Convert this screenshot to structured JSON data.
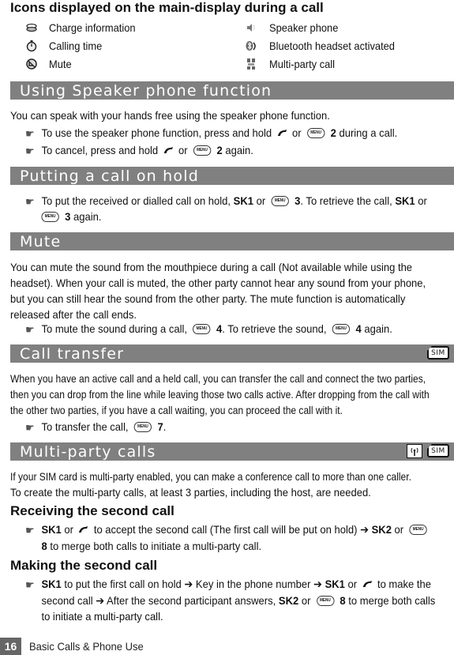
{
  "title": "Icons displayed on the main-display during a call",
  "icons": {
    "left": [
      {
        "icon": "charge-info-icon",
        "label": "Charge information"
      },
      {
        "icon": "stopwatch-icon",
        "label": "Calling time"
      },
      {
        "icon": "mute-icon",
        "label": "Mute"
      }
    ],
    "right": [
      {
        "icon": "speaker-icon",
        "label": "Speaker phone"
      },
      {
        "icon": "bluetooth-headset-icon",
        "label": "Bluetooth headset activated"
      },
      {
        "icon": "multi-party-icon",
        "label": "Multi-party call"
      }
    ]
  },
  "keys": {
    "menu": "MENU",
    "sim": "SIM",
    "hand": "☛",
    "arrow": "➔"
  },
  "speaker": {
    "heading": "Using Speaker phone function",
    "intro": "You can speak with your hands free using the speaker phone function.",
    "b1": {
      "t1": "To use the speaker phone function, press and hold",
      "t2": "or",
      "t3": "2",
      "t4": "during a call."
    },
    "b2": {
      "t1": "To cancel, press and hold",
      "t2": "or",
      "t3": "2",
      "t4": "again."
    }
  },
  "hold": {
    "heading": "Putting a call on hold",
    "b1": {
      "t1": "To put the received or dialled call on hold,",
      "k1": "SK1",
      "t2": "or",
      "k2": "3",
      "t3": ". To retrieve the call,",
      "k3": "SK1",
      "t4": "or",
      "k4": "3",
      "t5": "again."
    }
  },
  "mute": {
    "heading": "Mute",
    "lines": [
      "You can mute the sound from the mouthpiece during a call (Not available while using the",
      "headset). When your call is muted, the other party cannot hear any sound from your phone,",
      "but you can still hear the sound from the other party. The mute function is automatically",
      "released after the call ends."
    ],
    "b1": {
      "t1": "To mute the sound during a call,",
      "k1": "4",
      "t2": ".  To retrieve the sound,",
      "k2": "4",
      "t3": "again."
    }
  },
  "transfer": {
    "heading": "Call transfer",
    "lines": [
      "When you have an active call and a held call, you can transfer the call and connect the two parties,",
      "then you can drop from the line while leaving those two calls active. After dropping from the call with",
      "the other two parties, if you have a call waiting, you can proceed the call with it."
    ],
    "b1": {
      "t1": "To transfer the call,",
      "k1": "7",
      "t2": "."
    }
  },
  "multiparty": {
    "heading": "Multi-party calls",
    "lines": [
      "If your SIM card is multi-party enabled, you can make a conference call to more than one caller.",
      "To create the multi-party calls, at least 3 parties, including the host, are needed."
    ],
    "receiving": {
      "heading": "Receiving the second call",
      "k1": "SK1",
      "t1": "or",
      "t2": "to accept the second call (The first call will be put on hold)",
      "k2": "SK2",
      "t3": "or",
      "k3": "8",
      "t4": "to merge both calls to initiate a multi-party call."
    },
    "making": {
      "heading": "Making the second call",
      "k1": "SK1",
      "t1": "to put the first call on hold",
      "t2": "Key in the phone number",
      "k2": "SK1",
      "t3": "or",
      "t4": "to make the",
      "t5": "second call",
      "t6": "After the second participant answers,",
      "k3": "SK2",
      "t7": "or",
      "k4": "8",
      "t8": "to merge both calls",
      "t9": "to initiate a multi-party call."
    }
  },
  "footer": {
    "page_number": "16",
    "chapter": "Basic Calls & Phone Use"
  }
}
